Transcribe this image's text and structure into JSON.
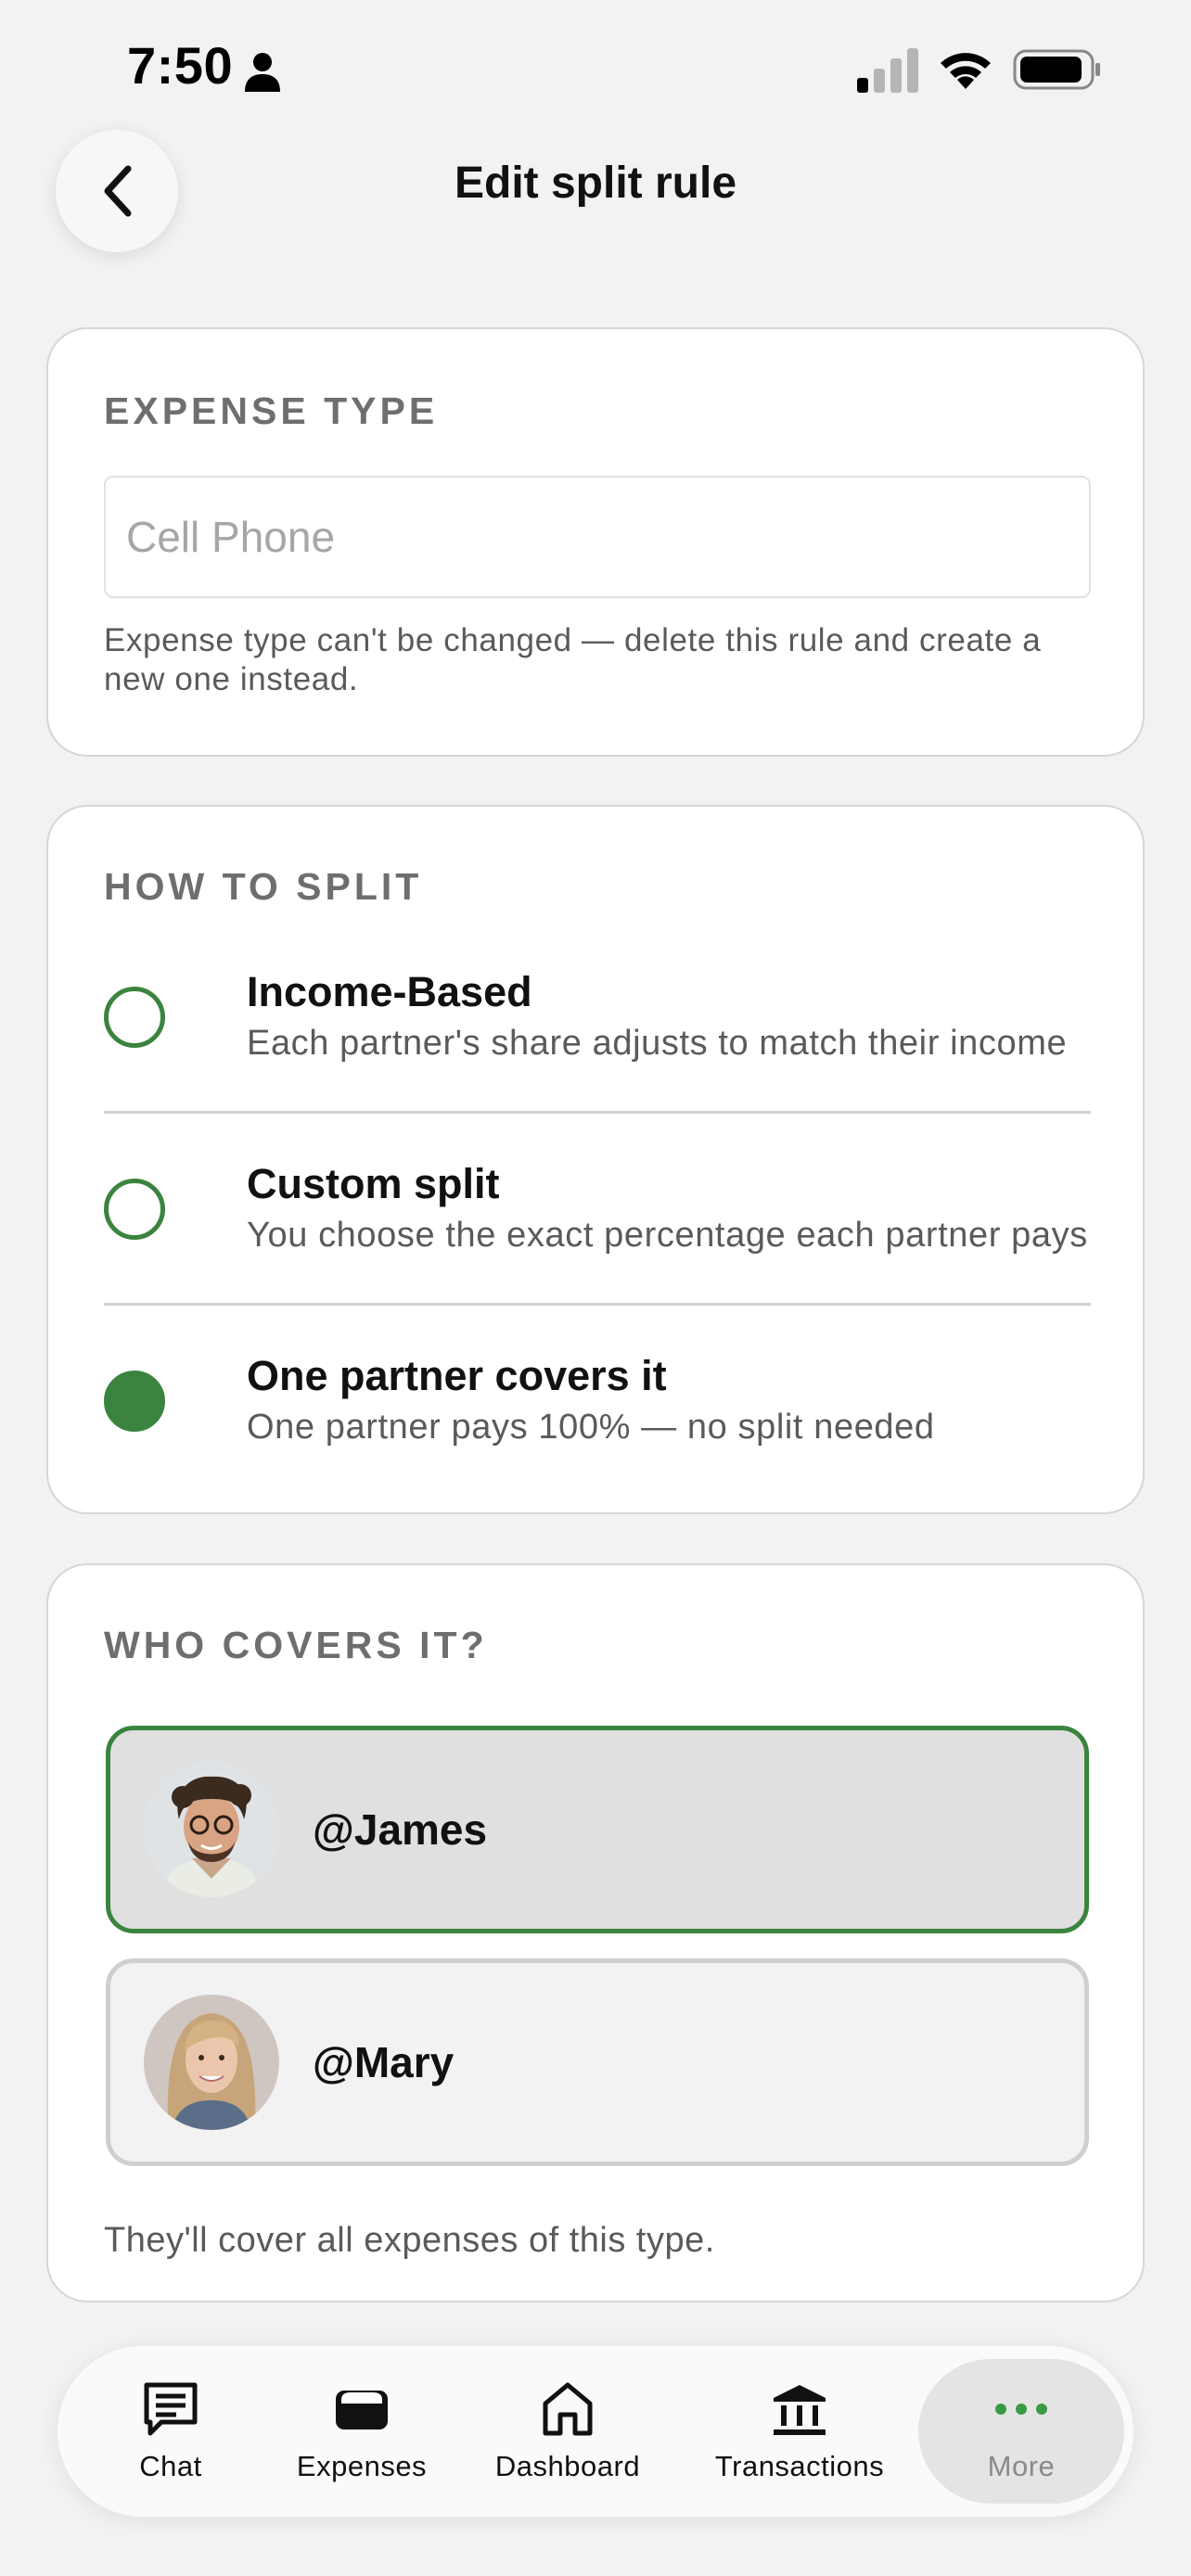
{
  "status_bar": {
    "time": "7:50",
    "icons": [
      "person-icon",
      "cellular-signal-icon",
      "wifi-icon",
      "battery-icon"
    ]
  },
  "header": {
    "title": "Edit split rule",
    "back_icon": "chevron-left-icon"
  },
  "expense_type": {
    "section_label": "EXPENSE TYPE",
    "value": "Cell Phone",
    "hint": "Expense type can't be changed — delete this rule and create a new one instead."
  },
  "how_to_split": {
    "section_label": "HOW TO SPLIT",
    "options": [
      {
        "title": "Income-Based",
        "description": "Each partner's share adjusts to match their income",
        "selected": false
      },
      {
        "title": "Custom split",
        "description": "You choose the exact percentage each partner pays",
        "selected": false
      },
      {
        "title": "One partner covers it",
        "description": "One partner pays 100% — no split needed",
        "selected": true
      }
    ]
  },
  "who_covers": {
    "section_label": "WHO COVERS IT?",
    "partners": [
      {
        "name": "@James",
        "selected": true
      },
      {
        "name": "@Mary",
        "selected": false
      }
    ],
    "hint": "They'll cover all expenses of this type."
  },
  "tab_bar": {
    "tabs": [
      {
        "label": "Chat",
        "icon": "chat-icon",
        "active": false
      },
      {
        "label": "Expenses",
        "icon": "wallet-icon",
        "active": false
      },
      {
        "label": "Dashboard",
        "icon": "home-icon",
        "active": false
      },
      {
        "label": "Transactions",
        "icon": "bank-icon",
        "active": false
      },
      {
        "label": "More",
        "icon": "more-dots-icon",
        "active": true
      }
    ]
  },
  "colors": {
    "accent_green": "#3a843f",
    "background": "#f2f2f2",
    "card": "#ffffff"
  }
}
